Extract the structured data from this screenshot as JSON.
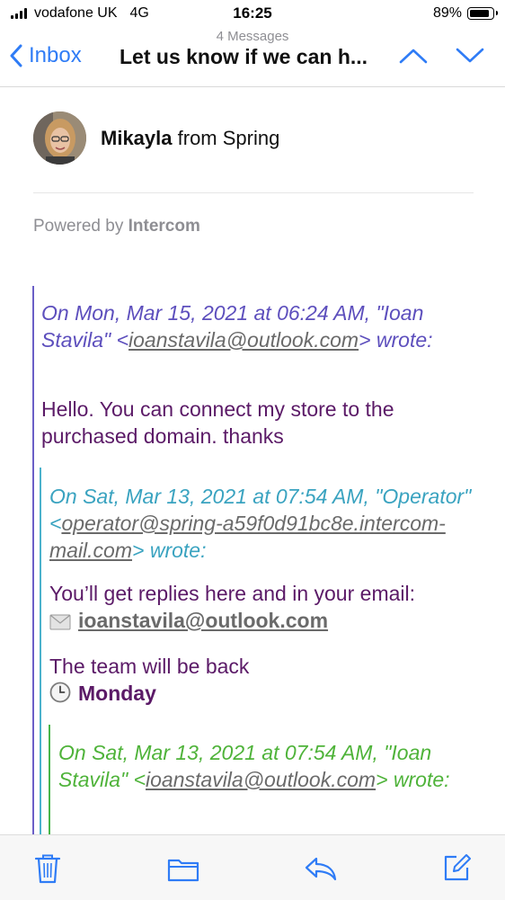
{
  "status_bar": {
    "carrier": "vodafone UK",
    "network": "4G",
    "time": "16:25",
    "battery": "89%",
    "battery_level": 0.89
  },
  "nav": {
    "subtitle": "4 Messages",
    "back_label": "Inbox",
    "title": "Let us know if we can h...",
    "accent_color": "#2f7cf6"
  },
  "sender": {
    "name": "Mikayla",
    "from_text": "from Spring"
  },
  "powered": {
    "prefix": "Powered by",
    "brand": "Intercom"
  },
  "quote1": {
    "attr_pre": "On Mon, Mar 15, 2021 at 06:24 AM, \"Ioan Stavila\" <",
    "attr_email": "ioanstavila@outlook.com",
    "attr_post": "> wrote:",
    "body": "Hello. You can connect my store to the purchased domain. thanks"
  },
  "quote2": {
    "attr_pre": "On Sat, Mar 13, 2021 at 07:54 AM, \"Operator\" <",
    "attr_email": "operator@spring-a59f0d91bc8e.intercom-mail.com",
    "attr_post": "> wrote:",
    "replies_text": "You’ll get replies here and in your email:",
    "reply_email": "ioanstavila@outlook.com",
    "team_text": "The team will be back",
    "team_day": "Monday"
  },
  "quote3": {
    "attr_pre": "On Sat, Mar 13, 2021 at 07:54 AM, \"Ioan Stavila\" <",
    "attr_email": "ioanstavila@outlook.com",
    "attr_post": "> wrote:"
  },
  "toolbar": {
    "icons": [
      "trash-icon",
      "folder-icon",
      "reply-icon",
      "compose-icon"
    ]
  }
}
